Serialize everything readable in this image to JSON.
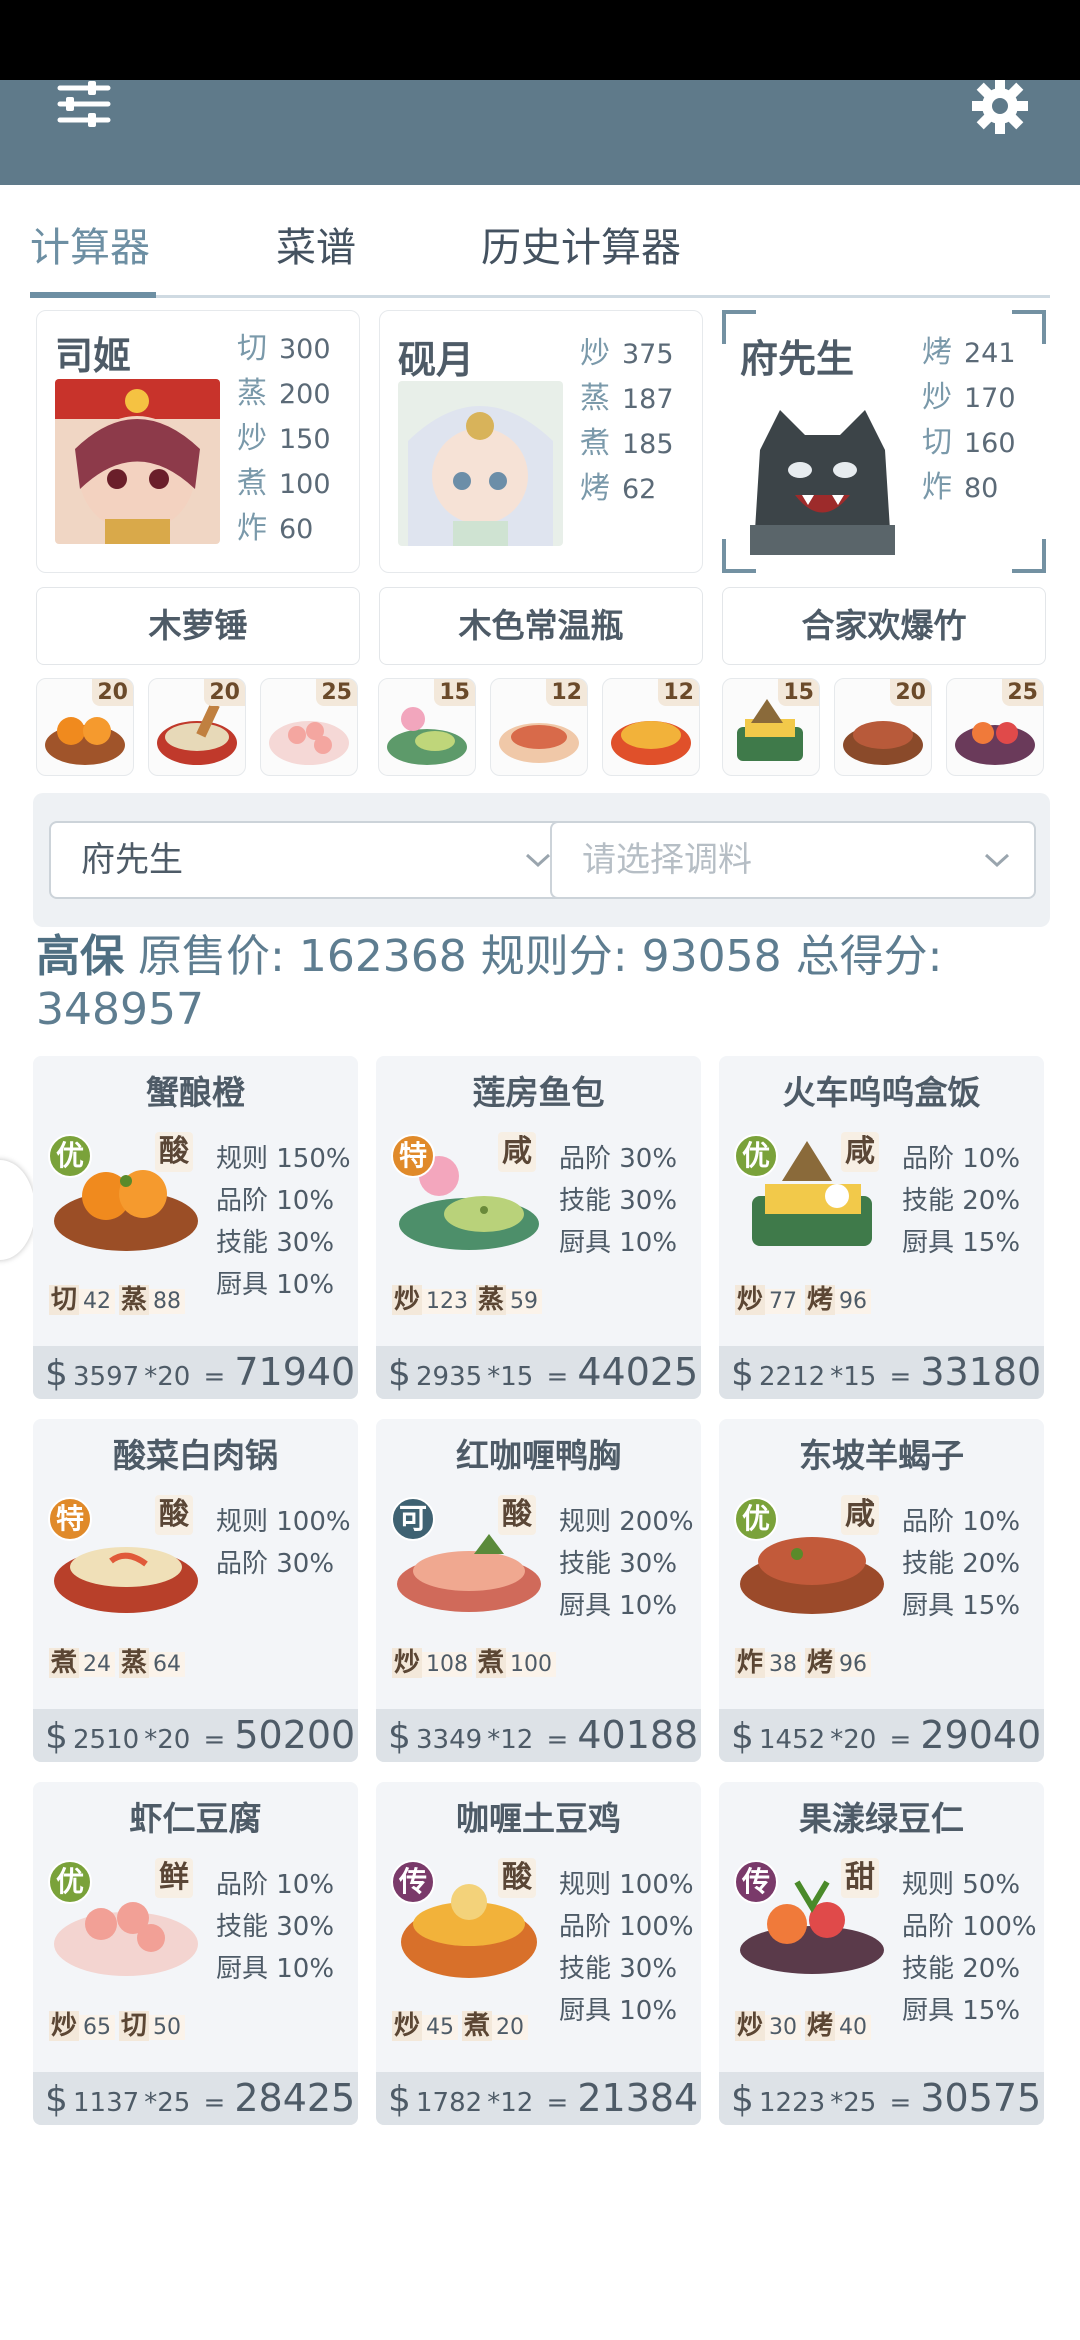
{
  "tabs": [
    {
      "label": "计算器",
      "active": true
    },
    {
      "label": "菜谱",
      "active": false
    },
    {
      "label": "历史计算器",
      "active": false
    }
  ],
  "icons": {
    "menu": "sliders-icon",
    "settings": "gear-icon"
  },
  "chefs": [
    {
      "name": "司姬",
      "stats": [
        {
          "k": "切",
          "v": "300"
        },
        {
          "k": "蒸",
          "v": "200"
        },
        {
          "k": "炒",
          "v": "150"
        },
        {
          "k": "煮",
          "v": "100"
        },
        {
          "k": "炸",
          "v": "60"
        }
      ]
    },
    {
      "name": "砚月",
      "stats": [
        {
          "k": "炒",
          "v": "375"
        },
        {
          "k": "蒸",
          "v": "187"
        },
        {
          "k": "煮",
          "v": "185"
        },
        {
          "k": "烤",
          "v": "62"
        }
      ]
    },
    {
      "name": "府先生",
      "stats": [
        {
          "k": "烤",
          "v": "241"
        },
        {
          "k": "炒",
          "v": "170"
        },
        {
          "k": "切",
          "v": "160"
        },
        {
          "k": "炸",
          "v": "80"
        }
      ],
      "selected": true
    }
  ],
  "tools": [
    "木萝锤",
    "木色常温瓶",
    "合家欢爆竹"
  ],
  "dish_counts": [
    "20",
    "20",
    "25",
    "15",
    "12",
    "12",
    "15",
    "20",
    "25"
  ],
  "selector": {
    "chef": "府先生",
    "seasoning_placeholder": "请选择调料"
  },
  "summary": {
    "grade": "高保",
    "orig_label": "原售价:",
    "orig_value": "162368",
    "rule_label": "规则分:",
    "rule_value": "93058",
    "total_label": "总得分:",
    "total_value": "348957"
  },
  "recipes": [
    {
      "name": "蟹酿橙",
      "grade": "优",
      "flavor": "酸",
      "bonuses": [
        "规则 150%",
        "品阶 10%",
        "技能 30%",
        "厨具 10%"
      ],
      "reqs": [
        {
          "k": "切",
          "v": "42"
        },
        {
          "k": "蒸",
          "v": "88"
        }
      ],
      "price": "3597",
      "qty": "*20",
      "total": "71940"
    },
    {
      "name": "莲房鱼包",
      "grade": "特",
      "flavor": "咸",
      "bonuses": [
        "品阶 30%",
        "技能 30%",
        "厨具 10%"
      ],
      "reqs": [
        {
          "k": "炒",
          "v": "123"
        },
        {
          "k": "蒸",
          "v": "59"
        }
      ],
      "price": "2935",
      "qty": "*15",
      "total": "44025"
    },
    {
      "name": "火车呜呜盒饭",
      "grade": "优",
      "flavor": "咸",
      "bonuses": [
        "品阶 10%",
        "技能 20%",
        "厨具 15%"
      ],
      "reqs": [
        {
          "k": "炒",
          "v": "77"
        },
        {
          "k": "烤",
          "v": "96"
        }
      ],
      "price": "2212",
      "qty": "*15",
      "total": "33180"
    },
    {
      "name": "酸菜白肉锅",
      "grade": "特",
      "flavor": "酸",
      "bonuses": [
        "规则 100%",
        "品阶 30%"
      ],
      "reqs": [
        {
          "k": "煮",
          "v": "24"
        },
        {
          "k": "蒸",
          "v": "64"
        }
      ],
      "price": "2510",
      "qty": "*20",
      "total": "50200"
    },
    {
      "name": "红咖喱鸭胸",
      "grade": "可",
      "flavor": "酸",
      "bonuses": [
        "规则 200%",
        "技能 30%",
        "厨具 10%"
      ],
      "reqs": [
        {
          "k": "炒",
          "v": "108"
        },
        {
          "k": "煮",
          "v": "100"
        }
      ],
      "price": "3349",
      "qty": "*12",
      "total": "40188"
    },
    {
      "name": "东坡羊蝎子",
      "grade": "优",
      "flavor": "咸",
      "bonuses": [
        "品阶 10%",
        "技能 20%",
        "厨具 15%"
      ],
      "reqs": [
        {
          "k": "炸",
          "v": "38"
        },
        {
          "k": "烤",
          "v": "96"
        }
      ],
      "price": "1452",
      "qty": "*20",
      "total": "29040"
    },
    {
      "name": "虾仁豆腐",
      "grade": "优",
      "flavor": "鲜",
      "bonuses": [
        "品阶 10%",
        "技能 30%",
        "厨具 10%"
      ],
      "reqs": [
        {
          "k": "炒",
          "v": "65"
        },
        {
          "k": "切",
          "v": "50"
        }
      ],
      "price": "1137",
      "qty": "*25",
      "total": "28425"
    },
    {
      "name": "咖喱土豆鸡",
      "grade": "传",
      "flavor": "酸",
      "bonuses": [
        "规则 100%",
        "品阶 100%",
        "技能 30%",
        "厨具 10%"
      ],
      "reqs": [
        {
          "k": "炒",
          "v": "45"
        },
        {
          "k": "煮",
          "v": "20"
        }
      ],
      "price": "1782",
      "qty": "*12",
      "total": "21384"
    },
    {
      "name": "果漾绿豆仁",
      "grade": "传",
      "flavor": "甜",
      "bonuses": [
        "规则 50%",
        "品阶 100%",
        "技能 20%",
        "厨具 15%"
      ],
      "reqs": [
        {
          "k": "炒",
          "v": "30"
        },
        {
          "k": "烤",
          "v": "40"
        }
      ],
      "price": "1223",
      "qty": "*25",
      "total": "30575"
    }
  ],
  "grade_colors": {
    "优": "#7aa23a",
    "特": "#e08a2a",
    "可": "#3f6272",
    "传": "#7a3a6a"
  }
}
